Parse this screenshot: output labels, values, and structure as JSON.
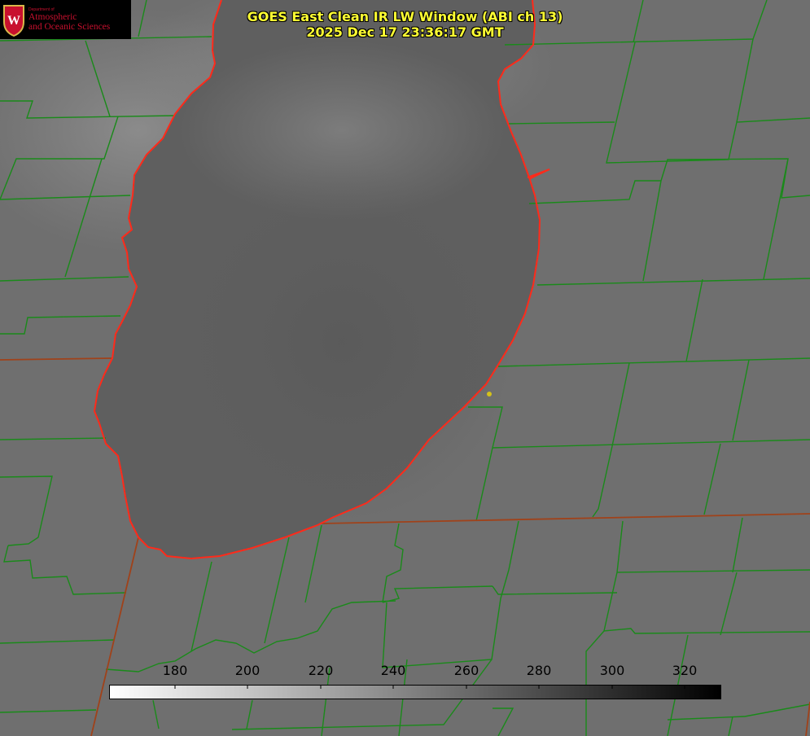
{
  "title": {
    "line1": "GOES East Clean IR LW Window (ABI ch 13)",
    "line2": "2025 Dec 17 23:36:17 GMT"
  },
  "logo": {
    "department": "Department of",
    "name_line1": "Atmospheric",
    "name_line2": "and Oceanic Sciences"
  },
  "colorbar": {
    "ticks": [
      "180",
      "200",
      "220",
      "240",
      "260",
      "280",
      "300",
      "320"
    ],
    "gradient_start": "#ffffff",
    "gradient_end": "#000000"
  },
  "colors": {
    "title": "#ffff33",
    "county_lines": "#1a8a1a",
    "state_lines": "#a0421a",
    "shoreline": "#ff2a1a",
    "marker": "#d4c21a"
  }
}
